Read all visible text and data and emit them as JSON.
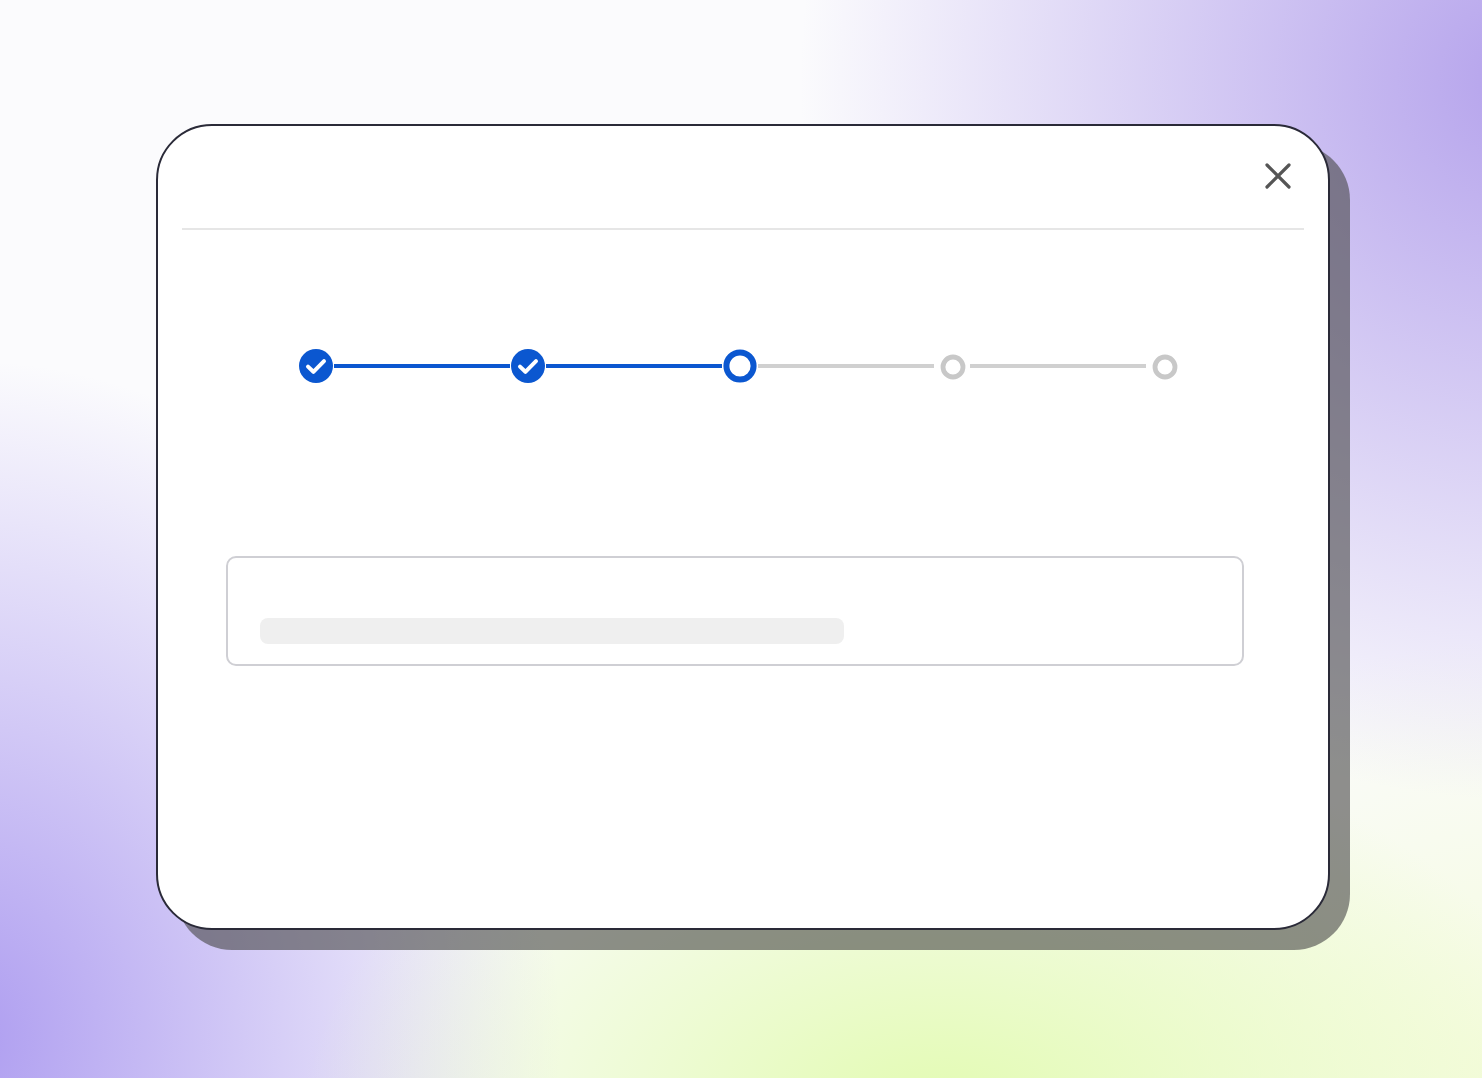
{
  "dialog": {
    "closable": true
  },
  "steps": [
    {
      "kind": "complete"
    },
    {
      "kind": "complete"
    },
    {
      "kind": "current"
    },
    {
      "kind": "upcoming"
    },
    {
      "kind": "upcoming"
    }
  ],
  "field": {
    "loading": true
  }
}
